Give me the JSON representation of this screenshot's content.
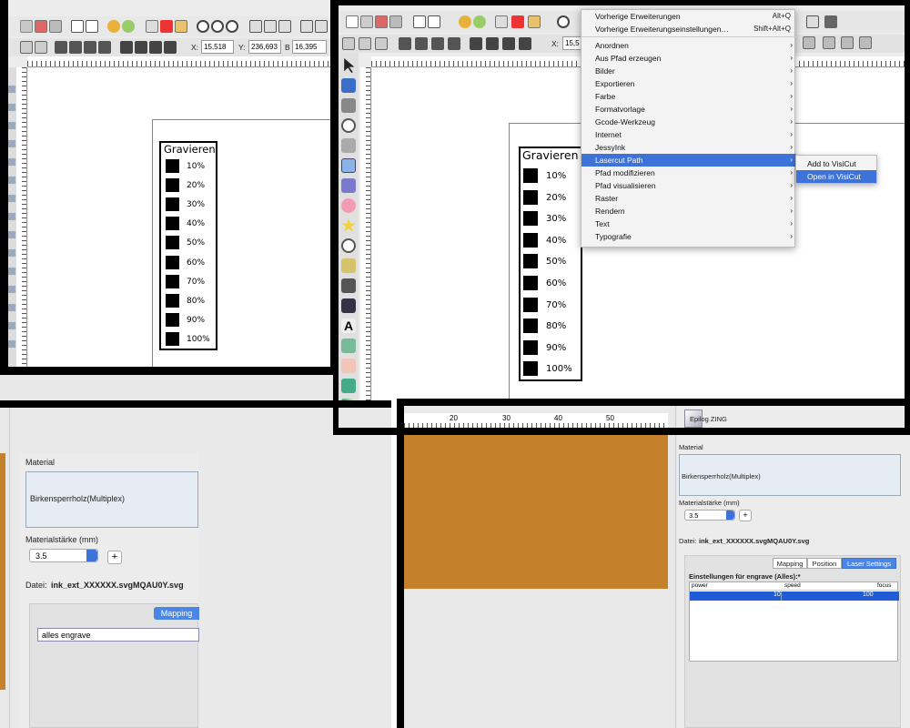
{
  "win1": {
    "coords": {
      "x_label": "X:",
      "x_value": "15,518",
      "y_label": "Y:",
      "y_value": "236,693",
      "w_label": "B",
      "w_value": "16,395"
    },
    "chart_title": "Gravieren",
    "levels": [
      "10%",
      "20%",
      "30%",
      "40%",
      "50%",
      "60%",
      "70%",
      "80%",
      "90%",
      "100%"
    ]
  },
  "win2": {
    "coords": {
      "x_label": "X:",
      "x_value": "15,5"
    },
    "chart_title": "Gravieren",
    "levels": [
      "10%",
      "20%",
      "30%",
      "40%",
      "50%",
      "60%",
      "70%",
      "80%",
      "90%",
      "100%"
    ],
    "menu": {
      "items": [
        {
          "label": "Vorherige Erweiterungen",
          "shortcut": "Alt+Q",
          "submenu": false
        },
        {
          "label": "Vorherige Erweiterungseinstellungen…",
          "shortcut": "Shift+Alt+Q",
          "submenu": false
        },
        {
          "label": "Anordnen",
          "shortcut": "",
          "submenu": true
        },
        {
          "label": "Aus Pfad erzeugen",
          "shortcut": "",
          "submenu": true
        },
        {
          "label": "Bilder",
          "shortcut": "",
          "submenu": true
        },
        {
          "label": "Exportieren",
          "shortcut": "",
          "submenu": true
        },
        {
          "label": "Farbe",
          "shortcut": "",
          "submenu": true
        },
        {
          "label": "Formatvorlage",
          "shortcut": "",
          "submenu": true
        },
        {
          "label": "Gcode-Werkzeug",
          "shortcut": "",
          "submenu": true
        },
        {
          "label": "Internet",
          "shortcut": "",
          "submenu": true
        },
        {
          "label": "JessyInk",
          "shortcut": "",
          "submenu": true
        },
        {
          "label": "Lasercut Path",
          "shortcut": "",
          "submenu": true
        },
        {
          "label": "Pfad modifizieren",
          "shortcut": "",
          "submenu": true
        },
        {
          "label": "Pfad visualisieren",
          "shortcut": "",
          "submenu": true
        },
        {
          "label": "Raster",
          "shortcut": "",
          "submenu": true
        },
        {
          "label": "Rendern",
          "shortcut": "",
          "submenu": true
        },
        {
          "label": "Text",
          "shortcut": "",
          "submenu": true
        },
        {
          "label": "Typografie",
          "shortcut": "",
          "submenu": true
        }
      ],
      "highlighted_index": 11,
      "submenu": {
        "items": [
          "Add to VisiCut",
          "Open in VisiCut"
        ],
        "highlighted_index": 1
      }
    }
  },
  "win3": {
    "material_label": "Material",
    "material_value": "Birkensperrholz(Multiplex)",
    "thickness_label": "Materialstärke (mm)",
    "thickness_value": "3.5",
    "plus": "+",
    "datei_label": "Datei:",
    "datei_value": "ink_ext_XXXXXX.svgMQAU0Y.svg",
    "tab_label": "Mapping",
    "mapping_value": "alles engrave"
  },
  "win4": {
    "ruler_labels": [
      "20",
      "30",
      "40",
      "50"
    ],
    "laser_name": "Epilog ZING",
    "material_label": "Material",
    "material_value": "Birkensperrholz(Multiplex)",
    "thickness_label": "Materialstärke (mm)",
    "thickness_value": "3.5",
    "plus": "+",
    "datei_label": "Datei:",
    "datei_value": "ink_ext_XXXXXX.svgMQAU0Y.svg",
    "tabs": [
      "Mapping",
      "Position",
      "Laser Settings"
    ],
    "active_tab": 2,
    "settings_title": "Einstellungen für engrave (Alles):*",
    "table_headers": [
      "power",
      "speed",
      "focus"
    ],
    "table_row": [
      "10",
      "100",
      ""
    ]
  },
  "colors": {
    "highlight": "#3d72d8",
    "tab_blue": "#4a86e8",
    "wood": "#c4802a"
  }
}
